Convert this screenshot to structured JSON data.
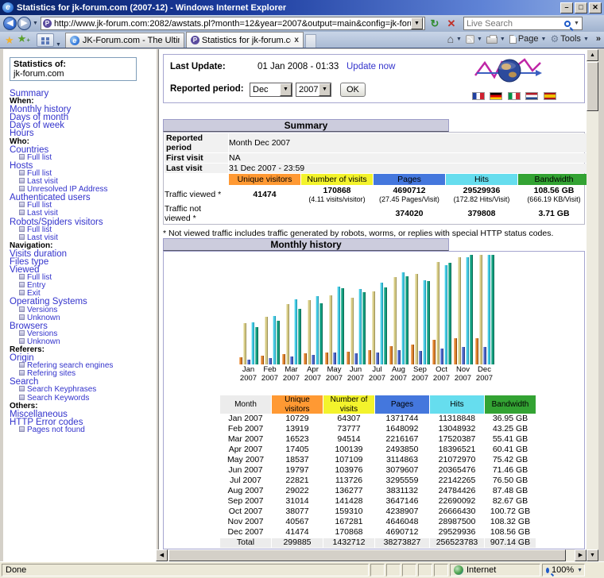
{
  "window": {
    "title": "Statistics for jk-forum.com (2007-12) - Windows Internet Explorer"
  },
  "nav": {
    "url": "http://www.jk-forum.com:2082/awstats.pl?month=12&year=2007&output=main&config=jk-forum.com&lang=en&f",
    "search_placeholder": "Live Search"
  },
  "tabs": [
    {
      "label": "JK-Forum.com - The Ultimate..."
    },
    {
      "label": "Statistics for jk-forum.co...",
      "close": "x"
    }
  ],
  "command_bar": {
    "page_label": "Page",
    "tools_label": "Tools",
    "more": "»"
  },
  "sidebar": {
    "title": "Statistics of:",
    "site": "jk-forum.com",
    "items": [
      {
        "label": "Summary",
        "type": "link"
      },
      {
        "label": "When:",
        "type": "header"
      },
      {
        "label": "Monthly history",
        "type": "link"
      },
      {
        "label": "Days of month",
        "type": "link"
      },
      {
        "label": "Days of week",
        "type": "link"
      },
      {
        "label": "Hours",
        "type": "link"
      },
      {
        "label": "Who:",
        "type": "header"
      },
      {
        "label": "Countries",
        "type": "link"
      },
      {
        "label": "Full list",
        "type": "sub"
      },
      {
        "label": "Hosts",
        "type": "link"
      },
      {
        "label": "Full list",
        "type": "sub"
      },
      {
        "label": "Last visit",
        "type": "sub"
      },
      {
        "label": "Unresolved IP Address",
        "type": "sub"
      },
      {
        "label": "Authenticated users",
        "type": "link"
      },
      {
        "label": "Full list",
        "type": "sub"
      },
      {
        "label": "Last visit",
        "type": "sub"
      },
      {
        "label": "Robots/Spiders visitors",
        "type": "link"
      },
      {
        "label": "Full list",
        "type": "sub"
      },
      {
        "label": "Last visit",
        "type": "sub"
      },
      {
        "label": "Navigation:",
        "type": "header"
      },
      {
        "label": "Visits duration",
        "type": "link"
      },
      {
        "label": "Files type",
        "type": "link"
      },
      {
        "label": "Viewed",
        "type": "link"
      },
      {
        "label": "Full list",
        "type": "sub"
      },
      {
        "label": "Entry",
        "type": "sub"
      },
      {
        "label": "Exit",
        "type": "sub"
      },
      {
        "label": "Operating Systems",
        "type": "link"
      },
      {
        "label": "Versions",
        "type": "sub"
      },
      {
        "label": "Unknown",
        "type": "sub"
      },
      {
        "label": "Browsers",
        "type": "link"
      },
      {
        "label": "Versions",
        "type": "sub"
      },
      {
        "label": "Unknown",
        "type": "sub"
      },
      {
        "label": "Referers:",
        "type": "header"
      },
      {
        "label": "Origin",
        "type": "link"
      },
      {
        "label": "Refering search engines",
        "type": "sub"
      },
      {
        "label": "Refering sites",
        "type": "sub"
      },
      {
        "label": "Search",
        "type": "link"
      },
      {
        "label": "Search Keyphrases",
        "type": "sub"
      },
      {
        "label": "Search Keywords",
        "type": "sub"
      },
      {
        "label": "Others:",
        "type": "header"
      },
      {
        "label": "Miscellaneous",
        "type": "link"
      },
      {
        "label": "HTTP Error codes",
        "type": "link"
      },
      {
        "label": "Pages not found",
        "type": "sub"
      }
    ]
  },
  "header_box": {
    "last_update_label": "Last Update:",
    "last_update_value": "01 Jan 2008 - 01:33",
    "update_now": "Update now",
    "reported_period_label": "Reported period:",
    "month_value": "Dec",
    "year_value": "2007",
    "ok_label": "OK",
    "flags": [
      "fr",
      "de",
      "it",
      "nl",
      "es"
    ]
  },
  "summary": {
    "title": "Summary",
    "info_rows": [
      [
        "Reported period",
        "Month Dec 2007"
      ],
      [
        "First visit",
        "NA"
      ],
      [
        "Last visit",
        "31 Dec 2007 - 23:59"
      ]
    ],
    "col_headers": [
      "Unique visitors",
      "Number of visits",
      "Pages",
      "Hits",
      "Bandwidth"
    ],
    "viewed_label": "Traffic viewed *",
    "viewed": [
      {
        "main": "41474",
        "sub": ""
      },
      {
        "main": "170868",
        "sub": "(4.11 visits/visitor)"
      },
      {
        "main": "4690712",
        "sub": "(27.45 Pages/Visit)"
      },
      {
        "main": "29529936",
        "sub": "(172.82 Hits/Visit)"
      },
      {
        "main": "108.56 GB",
        "sub": "(666.19 KB/Visit)"
      }
    ],
    "not_viewed_label": "Traffic not viewed *",
    "not_viewed": [
      "",
      "",
      "374020",
      "379808",
      "3.71 GB"
    ],
    "footnote": "* Not viewed traffic includes traffic generated by robots, worms, or replies with special HTTP status codes."
  },
  "monthly": {
    "title": "Monthly history",
    "headers": [
      "Month",
      "Unique visitors",
      "Number of visits",
      "Pages",
      "Hits",
      "Bandwidth"
    ],
    "rows": [
      [
        "Jan 2007",
        "10729",
        "64307",
        "1371744",
        "11318848",
        "36.95 GB"
      ],
      [
        "Feb 2007",
        "13919",
        "73777",
        "1648092",
        "13048932",
        "43.25 GB"
      ],
      [
        "Mar 2007",
        "16523",
        "94514",
        "2216167",
        "17520387",
        "55.41 GB"
      ],
      [
        "Apr 2007",
        "17405",
        "100139",
        "2493850",
        "18396521",
        "60.41 GB"
      ],
      [
        "May 2007",
        "18537",
        "107109",
        "3114863",
        "21072970",
        "75.42 GB"
      ],
      [
        "Jun 2007",
        "19797",
        "103976",
        "3079607",
        "20365476",
        "71.46 GB"
      ],
      [
        "Jul 2007",
        "22821",
        "113726",
        "3295559",
        "22142265",
        "76.50 GB"
      ],
      [
        "Aug 2007",
        "29022",
        "136277",
        "3831132",
        "24784426",
        "87.48 GB"
      ],
      [
        "Sep 2007",
        "31014",
        "141428",
        "3647146",
        "22690092",
        "82.67 GB"
      ],
      [
        "Oct 2007",
        "38077",
        "159310",
        "4238907",
        "26666430",
        "100.72 GB"
      ],
      [
        "Nov 2007",
        "40567",
        "167281",
        "4646048",
        "28987500",
        "108.32 GB"
      ],
      [
        "Dec 2007",
        "41474",
        "170868",
        "4690712",
        "29529936",
        "108.56 GB"
      ]
    ],
    "total": [
      "Total",
      "299885",
      "1432712",
      "38273827",
      "256523783",
      "907.14 GB"
    ]
  },
  "chart_data": {
    "type": "bar",
    "title": "Monthly history",
    "categories": [
      "Jan 2007",
      "Feb 2007",
      "Mar 2007",
      "Apr 2007",
      "May 2007",
      "Jun 2007",
      "Jul 2007",
      "Aug 2007",
      "Sep 2007",
      "Oct 2007",
      "Nov 2007",
      "Dec 2007"
    ],
    "series": [
      {
        "name": "Unique visitors",
        "values": [
          10729,
          13919,
          16523,
          17405,
          18537,
          19797,
          22821,
          29022,
          31014,
          38077,
          40567,
          41474
        ]
      },
      {
        "name": "Number of visits",
        "values": [
          64307,
          73777,
          94514,
          100139,
          107109,
          103976,
          113726,
          136277,
          141428,
          159310,
          167281,
          170868
        ]
      },
      {
        "name": "Pages",
        "values": [
          1371744,
          1648092,
          2216167,
          2493850,
          3114863,
          3079607,
          3295559,
          3831132,
          3647146,
          4238907,
          4646048,
          4690712
        ]
      },
      {
        "name": "Hits",
        "values": [
          11318848,
          13048932,
          17520387,
          18396521,
          21072970,
          20365476,
          22142265,
          24784426,
          22690092,
          26666430,
          28987500,
          29529936
        ]
      },
      {
        "name": "Bandwidth (GB)",
        "values": [
          36.95,
          43.25,
          55.41,
          60.41,
          75.42,
          71.46,
          76.5,
          87.48,
          82.67,
          100.72,
          108.32,
          108.56
        ]
      }
    ],
    "scaling_note": "unique+visits scaled to max visits; pages+hits scaled to max hits; bandwidth scaled to its own max",
    "grid": false,
    "legend_position": "none"
  },
  "colors": {
    "table_headers": [
      "#ECECEC",
      "#FF9933",
      "#F3F32C",
      "#4477DD",
      "#66DDEE",
      "#33A333"
    ],
    "chart_bars": [
      {
        "light": "#F2B277",
        "base": "#DE8330",
        "dark": "#8F4A0E"
      },
      {
        "light": "#EFE9C0",
        "base": "#D5CA85",
        "dark": "#9E935A"
      },
      {
        "light": "#8FA2E2",
        "base": "#4C66C6",
        "dark": "#2B3C85"
      },
      {
        "light": "#C2EFF8",
        "base": "#45CBE3",
        "dark": "#1F94AE"
      },
      {
        "light": "#5BC4AC",
        "base": "#149E7F",
        "dark": "#0A6B55"
      }
    ],
    "section_title_bg": "#CCCCDD",
    "box_border": "#A6A6CF",
    "link_color": "#3333CC"
  },
  "status_bar": {
    "text": "Done",
    "zone": "Internet",
    "zoom": "100%",
    "zoom_drop": "▾"
  }
}
